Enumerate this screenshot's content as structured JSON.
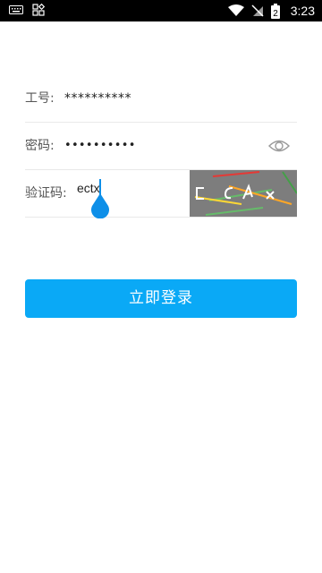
{
  "status_bar": {
    "time": "3:23",
    "battery_level": "2",
    "icons": [
      "keyboard-icon",
      "app-grid-icon",
      "wifi-icon",
      "no-sim-icon",
      "battery-icon"
    ]
  },
  "form": {
    "employee_id": {
      "label": "工号:",
      "value": "**********"
    },
    "password": {
      "label": "密码:",
      "value": "••••••••••",
      "toggle_icon": "eye-icon"
    },
    "captcha": {
      "label": "验证码:",
      "value": "ectx",
      "image_text": "E C A X"
    }
  },
  "login_button": {
    "label": "立即登录"
  },
  "colors": {
    "accent": "#0aa9f6",
    "cursor": "#0e8fe8",
    "captcha_bg": "#7d7d7d"
  }
}
